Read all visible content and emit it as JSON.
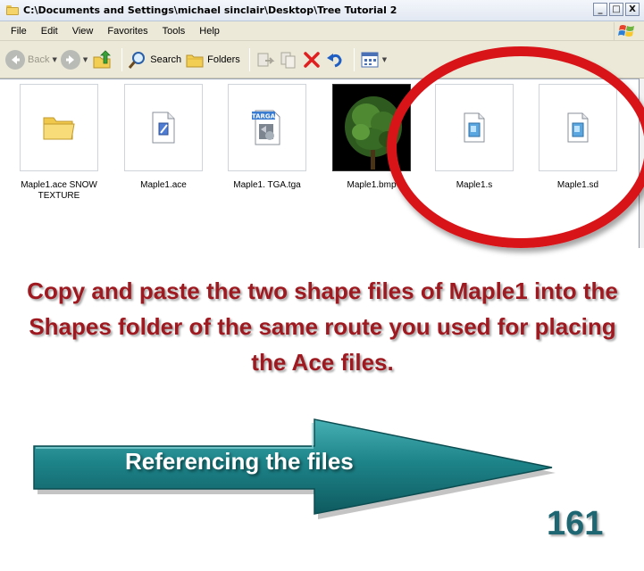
{
  "window": {
    "title": "C:\\Documents and Settings\\michael sinclair\\Desktop\\Tree Tutorial 2",
    "minimize": "_",
    "maximize": "□",
    "close": "X"
  },
  "menu": {
    "items": [
      "File",
      "Edit",
      "View",
      "Favorites",
      "Tools",
      "Help"
    ]
  },
  "toolbar": {
    "back_label": "Back",
    "search_label": "Search",
    "folders_label": "Folders"
  },
  "files": [
    {
      "name": "Maple1.ace SNOW TEXTURE",
      "icon": "folder-icon"
    },
    {
      "name": "Maple1.ace",
      "icon": "ace-file-icon"
    },
    {
      "name": "Maple1. TGA.tga",
      "icon": "targa-file-icon"
    },
    {
      "name": "Maple1.bmp",
      "icon": "tree-thumbnail"
    },
    {
      "name": "Maple1.s",
      "icon": "shape-file-icon"
    },
    {
      "name": "Maple1.sd",
      "icon": "shape-file-icon"
    }
  ],
  "overlay": {
    "instruction": "Copy and paste the two shape files of Maple1 into the Shapes folder of the same route you used for placing the Ace files.",
    "arrow_label": "Referencing the files",
    "page_number": "161"
  },
  "colors": {
    "highlight_ring": "#d91419",
    "instruction_text": "#9e1a20",
    "arrow_fill": "#1b7f85",
    "page_number": "#1e6672"
  }
}
